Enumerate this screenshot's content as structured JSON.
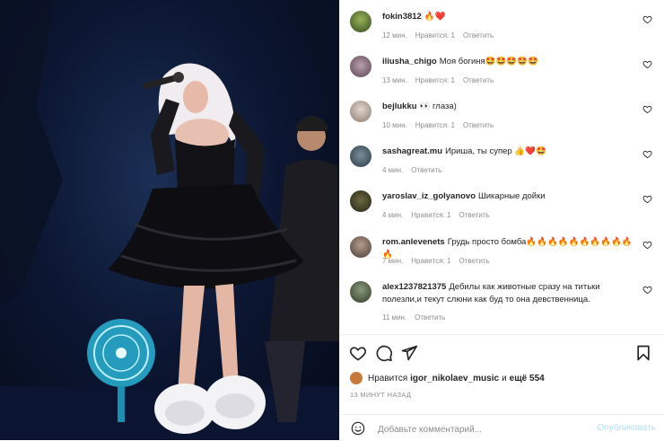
{
  "comments": [
    {
      "username": "fokin3812",
      "text": "🔥❤️",
      "time": "12 мин.",
      "likes": "Нравится: 1",
      "reply": "Ответить"
    },
    {
      "username": "iliusha_chigo",
      "text": "Моя богиня🤩🤩🤩🤩🤩",
      "time": "13 мин.",
      "likes": "Нравится: 1",
      "reply": "Ответить"
    },
    {
      "username": "bejlukku",
      "text": "👀 глаза)",
      "time": "10 мин.",
      "likes": "Нравится: 1",
      "reply": "Ответить"
    },
    {
      "username": "sashagreat.mu",
      "text": "Ириша, ты супер 👍❤️🤩",
      "time": "4 мин.",
      "reply": "Ответить"
    },
    {
      "username": "yaroslav_iz_golyanovo",
      "text": "Шикарные дойки",
      "time": "4 мин.",
      "likes": "Нравится: 1",
      "reply": "Ответить"
    },
    {
      "username": "rom.anlevenets",
      "text": "Грудь просто бомба🔥🔥🔥🔥🔥🔥🔥🔥🔥🔥🔥",
      "time": "7 мин.",
      "likes": "Нравится: 1",
      "reply": "Ответить"
    },
    {
      "username": "alex1237821375",
      "text": "Дебилы как животные сразу на титьки полезли,и текут слюни как буд то она девственница.",
      "time": "11 мин.",
      "reply": "Ответить"
    }
  ],
  "likes_line": {
    "prefix": "Нравится",
    "user": "igor_nikolaev_music",
    "middle": "и",
    "rest": "ещё 554"
  },
  "timestamp": "13 МИНУТ НАЗАД",
  "add_comment": {
    "placeholder": "Добавьте комментарий...",
    "publish_label": "Опубликовать"
  },
  "icons": {
    "like": "heart-icon",
    "comment": "comment-icon",
    "share": "paper-plane-icon",
    "save": "bookmark-icon",
    "emoji": "smiley-icon"
  },
  "colors": {
    "publish_disabled": "#b2dffc",
    "meta_grey": "#8e8e8e",
    "text": "#262626"
  }
}
